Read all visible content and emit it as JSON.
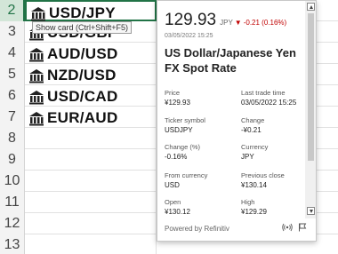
{
  "rows": [
    {
      "num": "2",
      "name": "USD/JPY"
    },
    {
      "num": "3",
      "name": "USD/GBP"
    },
    {
      "num": "4",
      "name": "AUD/USD"
    },
    {
      "num": "5",
      "name": "NZD/USD"
    },
    {
      "num": "6",
      "name": "USD/CAD"
    },
    {
      "num": "7",
      "name": "EUR/AUD"
    },
    {
      "num": "8",
      "name": ""
    },
    {
      "num": "9",
      "name": ""
    },
    {
      "num": "10",
      "name": ""
    },
    {
      "num": "11",
      "name": ""
    },
    {
      "num": "12",
      "name": ""
    },
    {
      "num": "13",
      "name": ""
    }
  ],
  "tooltip": "Show card (Ctrl+Shift+F5)",
  "card": {
    "price": "129.93",
    "currency": "JPY",
    "down_arrow": "▼",
    "change": "-0.21 (0.16%)",
    "timestamp": "03/05/2022 15:25",
    "title": "US Dollar/Japanese Yen FX Spot Rate",
    "fields": [
      {
        "label": "Price",
        "value": "¥129.93"
      },
      {
        "label": "Last trade time",
        "value": "03/05/2022 15:25"
      },
      {
        "label": "Ticker symbol",
        "value": "USDJPY"
      },
      {
        "label": "Change",
        "value": "-¥0.21"
      },
      {
        "label": "Change (%)",
        "value": "-0.16%"
      },
      {
        "label": "Currency",
        "value": "JPY"
      },
      {
        "label": "From currency",
        "value": "USD"
      },
      {
        "label": "Previous close",
        "value": "¥130.14"
      },
      {
        "label": "Open",
        "value": "¥130.12"
      },
      {
        "label": "High",
        "value": "¥129.29"
      }
    ],
    "footer": "Powered by Refinitiv"
  },
  "colors": {
    "accent": "#217346",
    "negative": "#c00000"
  }
}
